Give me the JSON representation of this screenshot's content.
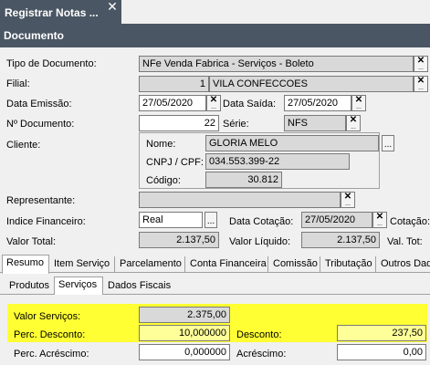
{
  "window": {
    "tab_title": "Registrar Notas ...",
    "close_glyph": "✕"
  },
  "section": {
    "title": "Documento"
  },
  "form": {
    "tipo_documento": {
      "label": "Tipo de Documento:",
      "value": "NFe Venda Fabrica - Serviços - Boleto"
    },
    "filial": {
      "label": "Filial:",
      "code": "1",
      "value": "VILA CONFECCOES"
    },
    "data_emissao": {
      "label": "Data Emissão:",
      "value": "27/05/2020"
    },
    "data_saida": {
      "label": "Data Saída:",
      "value": "27/05/2020"
    },
    "numero_documento": {
      "label": "Nº Documento:",
      "value": "22"
    },
    "serie": {
      "label": "Série:",
      "value": "NFS"
    },
    "cliente": {
      "label": "Cliente:",
      "nome_label": "Nome:",
      "nome": "GLORIA MELO",
      "cnpj_label": "CNPJ / CPF:",
      "cnpj": "034.553.399-22",
      "codigo_label": "Código:",
      "codigo": "30.812"
    },
    "representante": {
      "label": "Representante:",
      "value": ""
    },
    "indice_financeiro": {
      "label": "Indice Financeiro:",
      "value": "Real"
    },
    "data_cotacao": {
      "label": "Data Cotação:",
      "value": "27/05/2020"
    },
    "cotacao": {
      "label": "Cotação:"
    },
    "valor_total": {
      "label": "Valor Total:",
      "value": "2.137,50"
    },
    "valor_liquido": {
      "label": "Valor Líquido:",
      "value": "2.137,50"
    },
    "val_tot": {
      "label": "Val. Tot:"
    }
  },
  "tabs": [
    "Resumo",
    "Item Serviço",
    "Parcelamento",
    "Conta Financeira",
    "Comissão",
    "Tributação",
    "Outros Dad"
  ],
  "subtabs": [
    "Produtos",
    "Serviços",
    "Dados Fiscais"
  ],
  "resumo": {
    "valor_servicos": {
      "label": "Valor Serviços:",
      "value": "2.375,00"
    },
    "perc_desconto": {
      "label": "Perc. Desconto:",
      "value": "10,000000"
    },
    "desconto": {
      "label": "Desconto:",
      "value": "237,50"
    },
    "perc_acrescimo": {
      "label": "Perc. Acréscimo:",
      "value": "0,000000"
    },
    "acrescimo": {
      "label": "Acréscimo:",
      "value": "0,00"
    }
  },
  "icons": {
    "clear": "✕",
    "dots": "..."
  },
  "colors": {
    "header_bg": "#4a5663",
    "highlight": "#ffff33",
    "readonly_bg": "#d9d9d9"
  }
}
